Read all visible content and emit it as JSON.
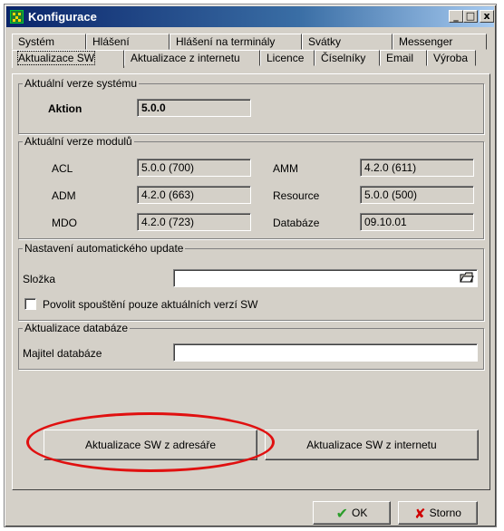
{
  "window": {
    "title": "Konfigurace",
    "controls": [
      "_",
      "□",
      "x"
    ]
  },
  "tabs": {
    "row1": [
      "Systém",
      "Hlášení",
      "Hlášení na terminály",
      "Svátky",
      "Messenger"
    ],
    "row2": [
      "Aktualizace SW",
      "Aktualizace z internetu",
      "Licence",
      "Číselníky",
      "Email",
      "Výroba"
    ],
    "active": "Aktualizace SW"
  },
  "system_version": {
    "group_label": "Aktuální verze systému",
    "name": "Aktion",
    "value": "5.0.0"
  },
  "modules": {
    "group_label": "Aktuální verze modulů",
    "left": [
      {
        "label": "ACL",
        "value": "5.0.0 (700)"
      },
      {
        "label": "ADM",
        "value": "4.2.0 (663)"
      },
      {
        "label": "MDO",
        "value": "4.2.0 (723)"
      }
    ],
    "right": [
      {
        "label": "AMM",
        "value": "4.2.0 (611)"
      },
      {
        "label": "Resource",
        "value": "5.0.0 (500)"
      },
      {
        "label": "Databáze",
        "value": "09.10.01"
      }
    ]
  },
  "auto_update": {
    "group_label": "Nastavení automatického update",
    "folder_label": "Složka",
    "folder_value": "",
    "checkbox_label": "Povolit spouštění pouze aktuálních verzí SW",
    "checkbox_checked": false
  },
  "db_update": {
    "group_label": "Aktualizace databáze",
    "owner_label": "Majitel databáze",
    "owner_value": ""
  },
  "actions": {
    "update_from_dir": "Aktualizace SW z adresáře",
    "update_from_internet": "Aktualizace SW z internetu"
  },
  "footer": {
    "ok": "OK",
    "cancel": "Storno"
  },
  "colors": {
    "highlight_ellipse": "#e01010"
  }
}
